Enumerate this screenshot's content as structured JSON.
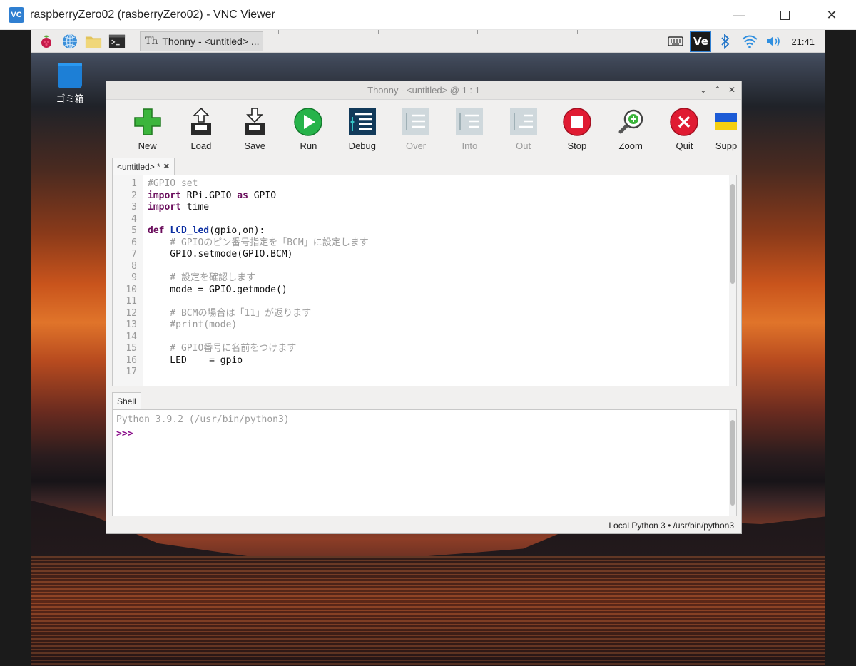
{
  "vnc": {
    "title": "raspberryZero02 (rasberryZero02) - VNC Viewer",
    "logo": "VC"
  },
  "panel": {
    "task_label": "Thonny  -  <untitled>  ...",
    "clock": "21:41"
  },
  "desktop": {
    "trash_label": "ゴミ箱"
  },
  "thonny": {
    "title": "Thonny  -  <untitled>  @  1 : 1",
    "toolbar": [
      {
        "label": "New",
        "icon": "new-icon",
        "enabled": true
      },
      {
        "label": "Load",
        "icon": "load-icon",
        "enabled": true
      },
      {
        "label": "Save",
        "icon": "save-icon",
        "enabled": true
      },
      {
        "label": "Run",
        "icon": "run-icon",
        "enabled": true
      },
      {
        "label": "Debug",
        "icon": "debug-icon",
        "enabled": true
      },
      {
        "label": "Over",
        "icon": "step-over-icon",
        "enabled": false
      },
      {
        "label": "Into",
        "icon": "step-into-icon",
        "enabled": false
      },
      {
        "label": "Out",
        "icon": "step-out-icon",
        "enabled": false
      },
      {
        "label": "Stop",
        "icon": "stop-icon",
        "enabled": true
      },
      {
        "label": "Zoom",
        "icon": "zoom-icon",
        "enabled": true
      },
      {
        "label": "Quit",
        "icon": "quit-icon",
        "enabled": true
      },
      {
        "label": "Supp",
        "icon": "support-ukraine-icon",
        "enabled": true
      }
    ],
    "editor_tab": "<untitled> *",
    "line_numbers": [
      "1",
      "2",
      "3",
      "4",
      "5",
      "6",
      "7",
      "8",
      "9",
      "10",
      "11",
      "12",
      "13",
      "14",
      "15",
      "16",
      "17"
    ],
    "code": [
      [
        {
          "t": "#GPIO set",
          "c": "cm"
        }
      ],
      [
        {
          "t": "import",
          "c": "kw"
        },
        {
          "t": " RPi.GPIO "
        },
        {
          "t": "as",
          "c": "kw"
        },
        {
          "t": " GPIO"
        }
      ],
      [
        {
          "t": "import",
          "c": "kw"
        },
        {
          "t": " time"
        }
      ],
      [
        {
          "t": ""
        }
      ],
      [
        {
          "t": "def",
          "c": "kw"
        },
        {
          "t": " "
        },
        {
          "t": "LCD_led",
          "c": "fn"
        },
        {
          "t": "(gpio,on):"
        }
      ],
      [
        {
          "t": "    # GPIOのピン番号指定を「BCM」に設定します",
          "c": "cm"
        }
      ],
      [
        {
          "t": "    GPIO.setmode(GPIO.BCM)"
        }
      ],
      [
        {
          "t": ""
        }
      ],
      [
        {
          "t": "    # 設定を確認します",
          "c": "cm"
        }
      ],
      [
        {
          "t": "    mode = GPIO.getmode()"
        }
      ],
      [
        {
          "t": ""
        }
      ],
      [
        {
          "t": "    # BCMの場合は「11」が返ります",
          "c": "cm"
        }
      ],
      [
        {
          "t": "    #print(mode)",
          "c": "cm"
        }
      ],
      [
        {
          "t": ""
        }
      ],
      [
        {
          "t": "    # GPIO番号に名前をつけます",
          "c": "cm"
        }
      ],
      [
        {
          "t": "    LED    = gpio"
        }
      ],
      [
        {
          "t": ""
        }
      ]
    ],
    "shell_tab": "Shell",
    "shell_version": "Python 3.9.2 (/usr/bin/python3)",
    "shell_prompt": ">>>",
    "status": "Local Python 3  •  /usr/bin/python3"
  }
}
